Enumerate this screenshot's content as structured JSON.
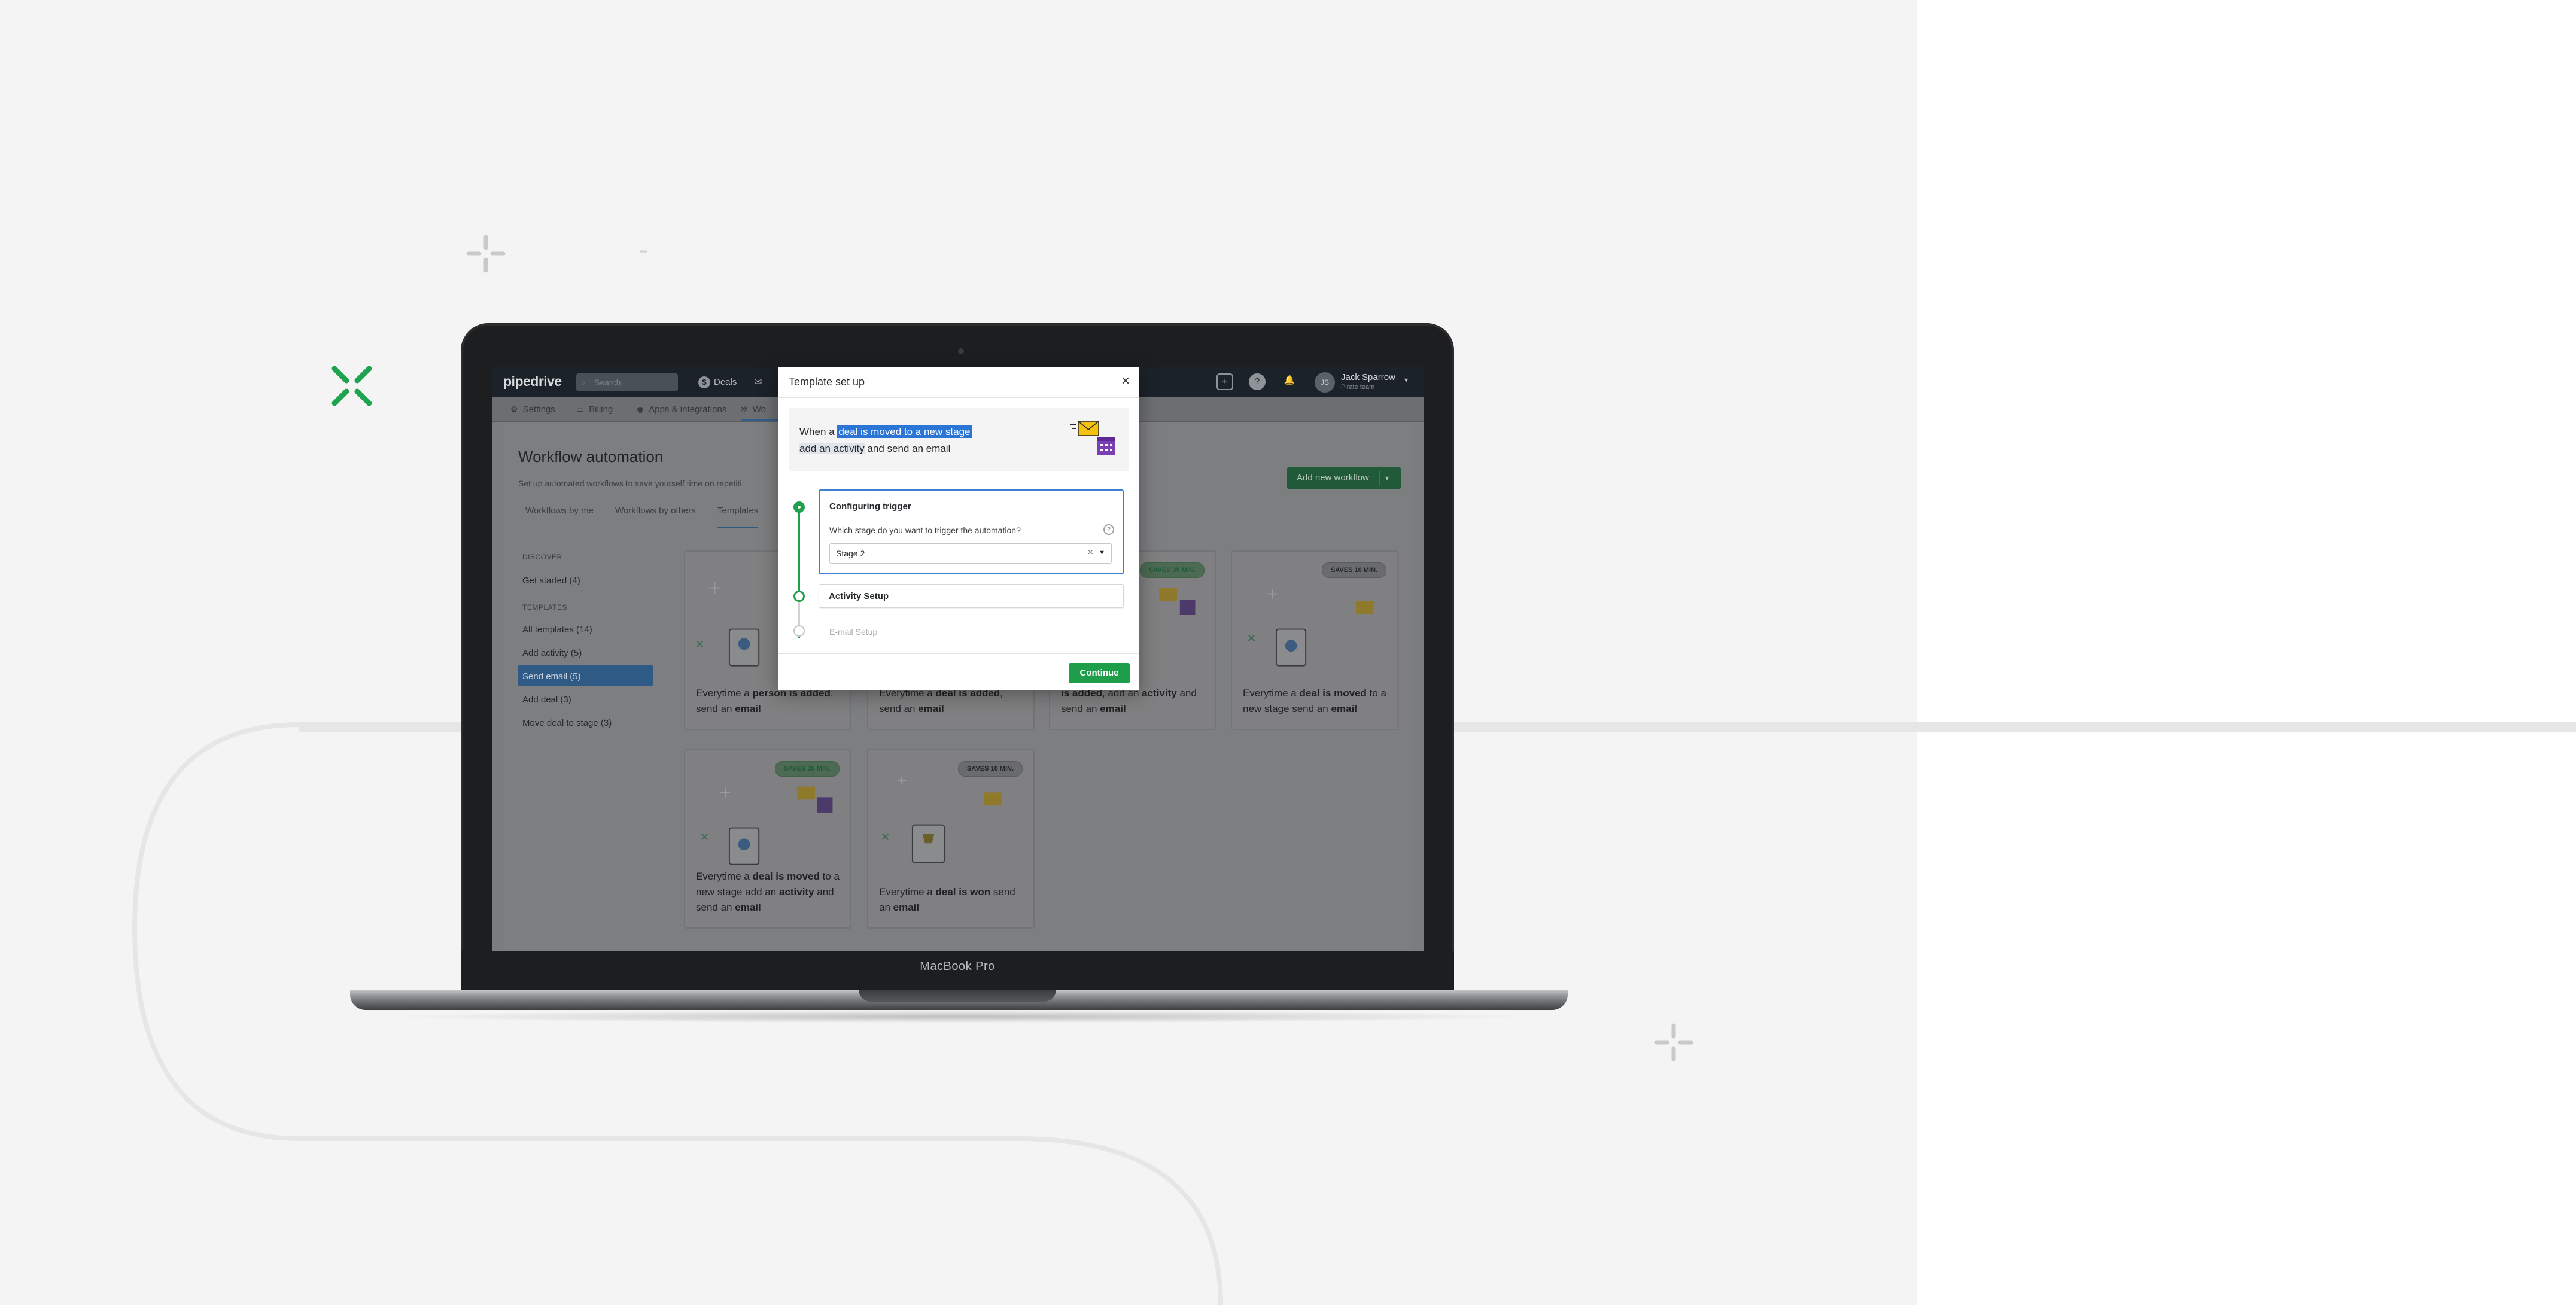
{
  "laptop": {
    "model_label": "MacBook Pro"
  },
  "app": {
    "logo": "pipedrive",
    "search_placeholder": "Search",
    "nav": {
      "deals": "Deals"
    },
    "user": {
      "name": "Jack Sparrow",
      "subtitle": "Pirate team",
      "initials": "JS"
    },
    "subnav": [
      {
        "label": "Settings",
        "icon": "gear-icon"
      },
      {
        "label": "Billing",
        "icon": "credit-card-icon"
      },
      {
        "label": "Apps & integrations",
        "icon": "grid-icon"
      },
      {
        "label": "Wo",
        "icon": "workflow-icon"
      }
    ],
    "page": {
      "title": "Workflow automation",
      "subtitle": "Set up automated workflows to save yourself time on repetiti",
      "add_button": "Add new workflow",
      "tabs": [
        "Workflows by me",
        "Workflows by others",
        "Templates"
      ]
    },
    "sidebar": {
      "discover_heading": "DISCOVER",
      "discover_items": [
        "Get started (4)"
      ],
      "templates_heading": "TEMPLATES",
      "template_items": [
        "All templates (14)",
        "Add activity (5)",
        "Send email (5)",
        "Add deal (3)",
        "Move deal to stage (3)"
      ],
      "selected_index": 2
    },
    "cards": [
      {
        "badge": "",
        "pre": "Everytime a ",
        "bold1": "person is added",
        "mid": ", send an ",
        "bold2": "email",
        "post": ""
      },
      {
        "badge": "",
        "pre": "Everytime a ",
        "bold1": "deal is added",
        "mid": ", send an ",
        "bold2": "email",
        "post": ""
      },
      {
        "badge": "SAVES 35 MIN.",
        "pre": "",
        "bold1": "is added",
        "mid": ", add an ",
        "bold2": "activity",
        "post": " and send an ",
        "bold3": "email"
      },
      {
        "badge": "SAVES 10 MIN.",
        "pre": "Everytime a ",
        "bold1": "deal is moved",
        "mid": " to a new stage send an ",
        "bold2": "email",
        "post": ""
      },
      {
        "badge": "SAVES 35 MIN.",
        "pre": "Everytime a ",
        "bold1": "deal is moved",
        "mid": " to a new stage add an ",
        "bold2": "activity",
        "post": " and send an ",
        "bold3": "email"
      },
      {
        "badge": "SAVES 10 MIN.",
        "pre": "Everytime a ",
        "bold1": "deal is won",
        "mid": " send an ",
        "bold2": "email",
        "post": ""
      }
    ]
  },
  "modal": {
    "title": "Template set up",
    "summary": {
      "prefix": "When a ",
      "highlight": "deal is moved to a new stage",
      "line2_a": "add an ",
      "line2_b": "activity",
      "line2_c": " and send an email"
    },
    "steps": [
      {
        "title": "Configuring trigger",
        "question": "Which stage do you want to trigger the automation?",
        "value": "Stage 2"
      },
      {
        "title": "Activity Setup"
      },
      {
        "title": "E-mail Setup"
      }
    ],
    "continue": "Continue"
  },
  "colors": {
    "accent_green": "#1e9e4a",
    "highlight_blue": "#2b75d6",
    "deco_green": "#1ea34f"
  }
}
